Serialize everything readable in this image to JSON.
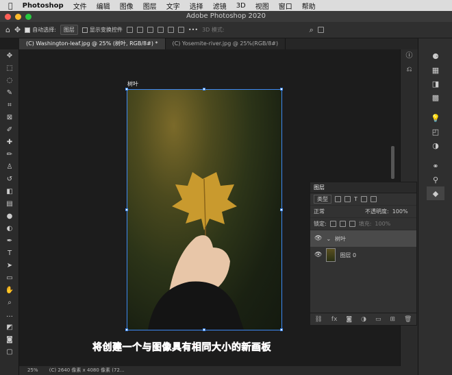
{
  "menubar": {
    "app": "Photoshop",
    "items": [
      "文件",
      "编辑",
      "图像",
      "图层",
      "文字",
      "选择",
      "滤镜",
      "3D",
      "视图",
      "窗口",
      "帮助"
    ]
  },
  "window": {
    "title": "Adobe Photoshop 2020"
  },
  "options": {
    "auto_select_label": "自动选择:",
    "auto_select_value": "图层",
    "transform_label": "显示变换控件",
    "mode3d": "3D 模式:"
  },
  "tabs": [
    {
      "label": "(C) Washington-leaf.jpg @ 25% (树叶, RGB/8#) *"
    },
    {
      "label": "(C) Yosemite-river.jpg @ 25%(RGB/8#)"
    }
  ],
  "artboard": {
    "label": "树叶"
  },
  "layers": {
    "title": "图层",
    "filter": "类型",
    "blend": "正常",
    "opacity_label": "不透明度:",
    "opacity_value": "100%",
    "lock_label": "锁定:",
    "fill_label": "填充:",
    "fill_value": "100%",
    "items": [
      {
        "name": "树叶"
      },
      {
        "name": "图层 0"
      }
    ]
  },
  "status": {
    "zoom": "25%",
    "info": "(C) 2640 像素 x 4080 像素 (72..."
  },
  "caption": "将创建一个与图像具有相同大小的新画板"
}
